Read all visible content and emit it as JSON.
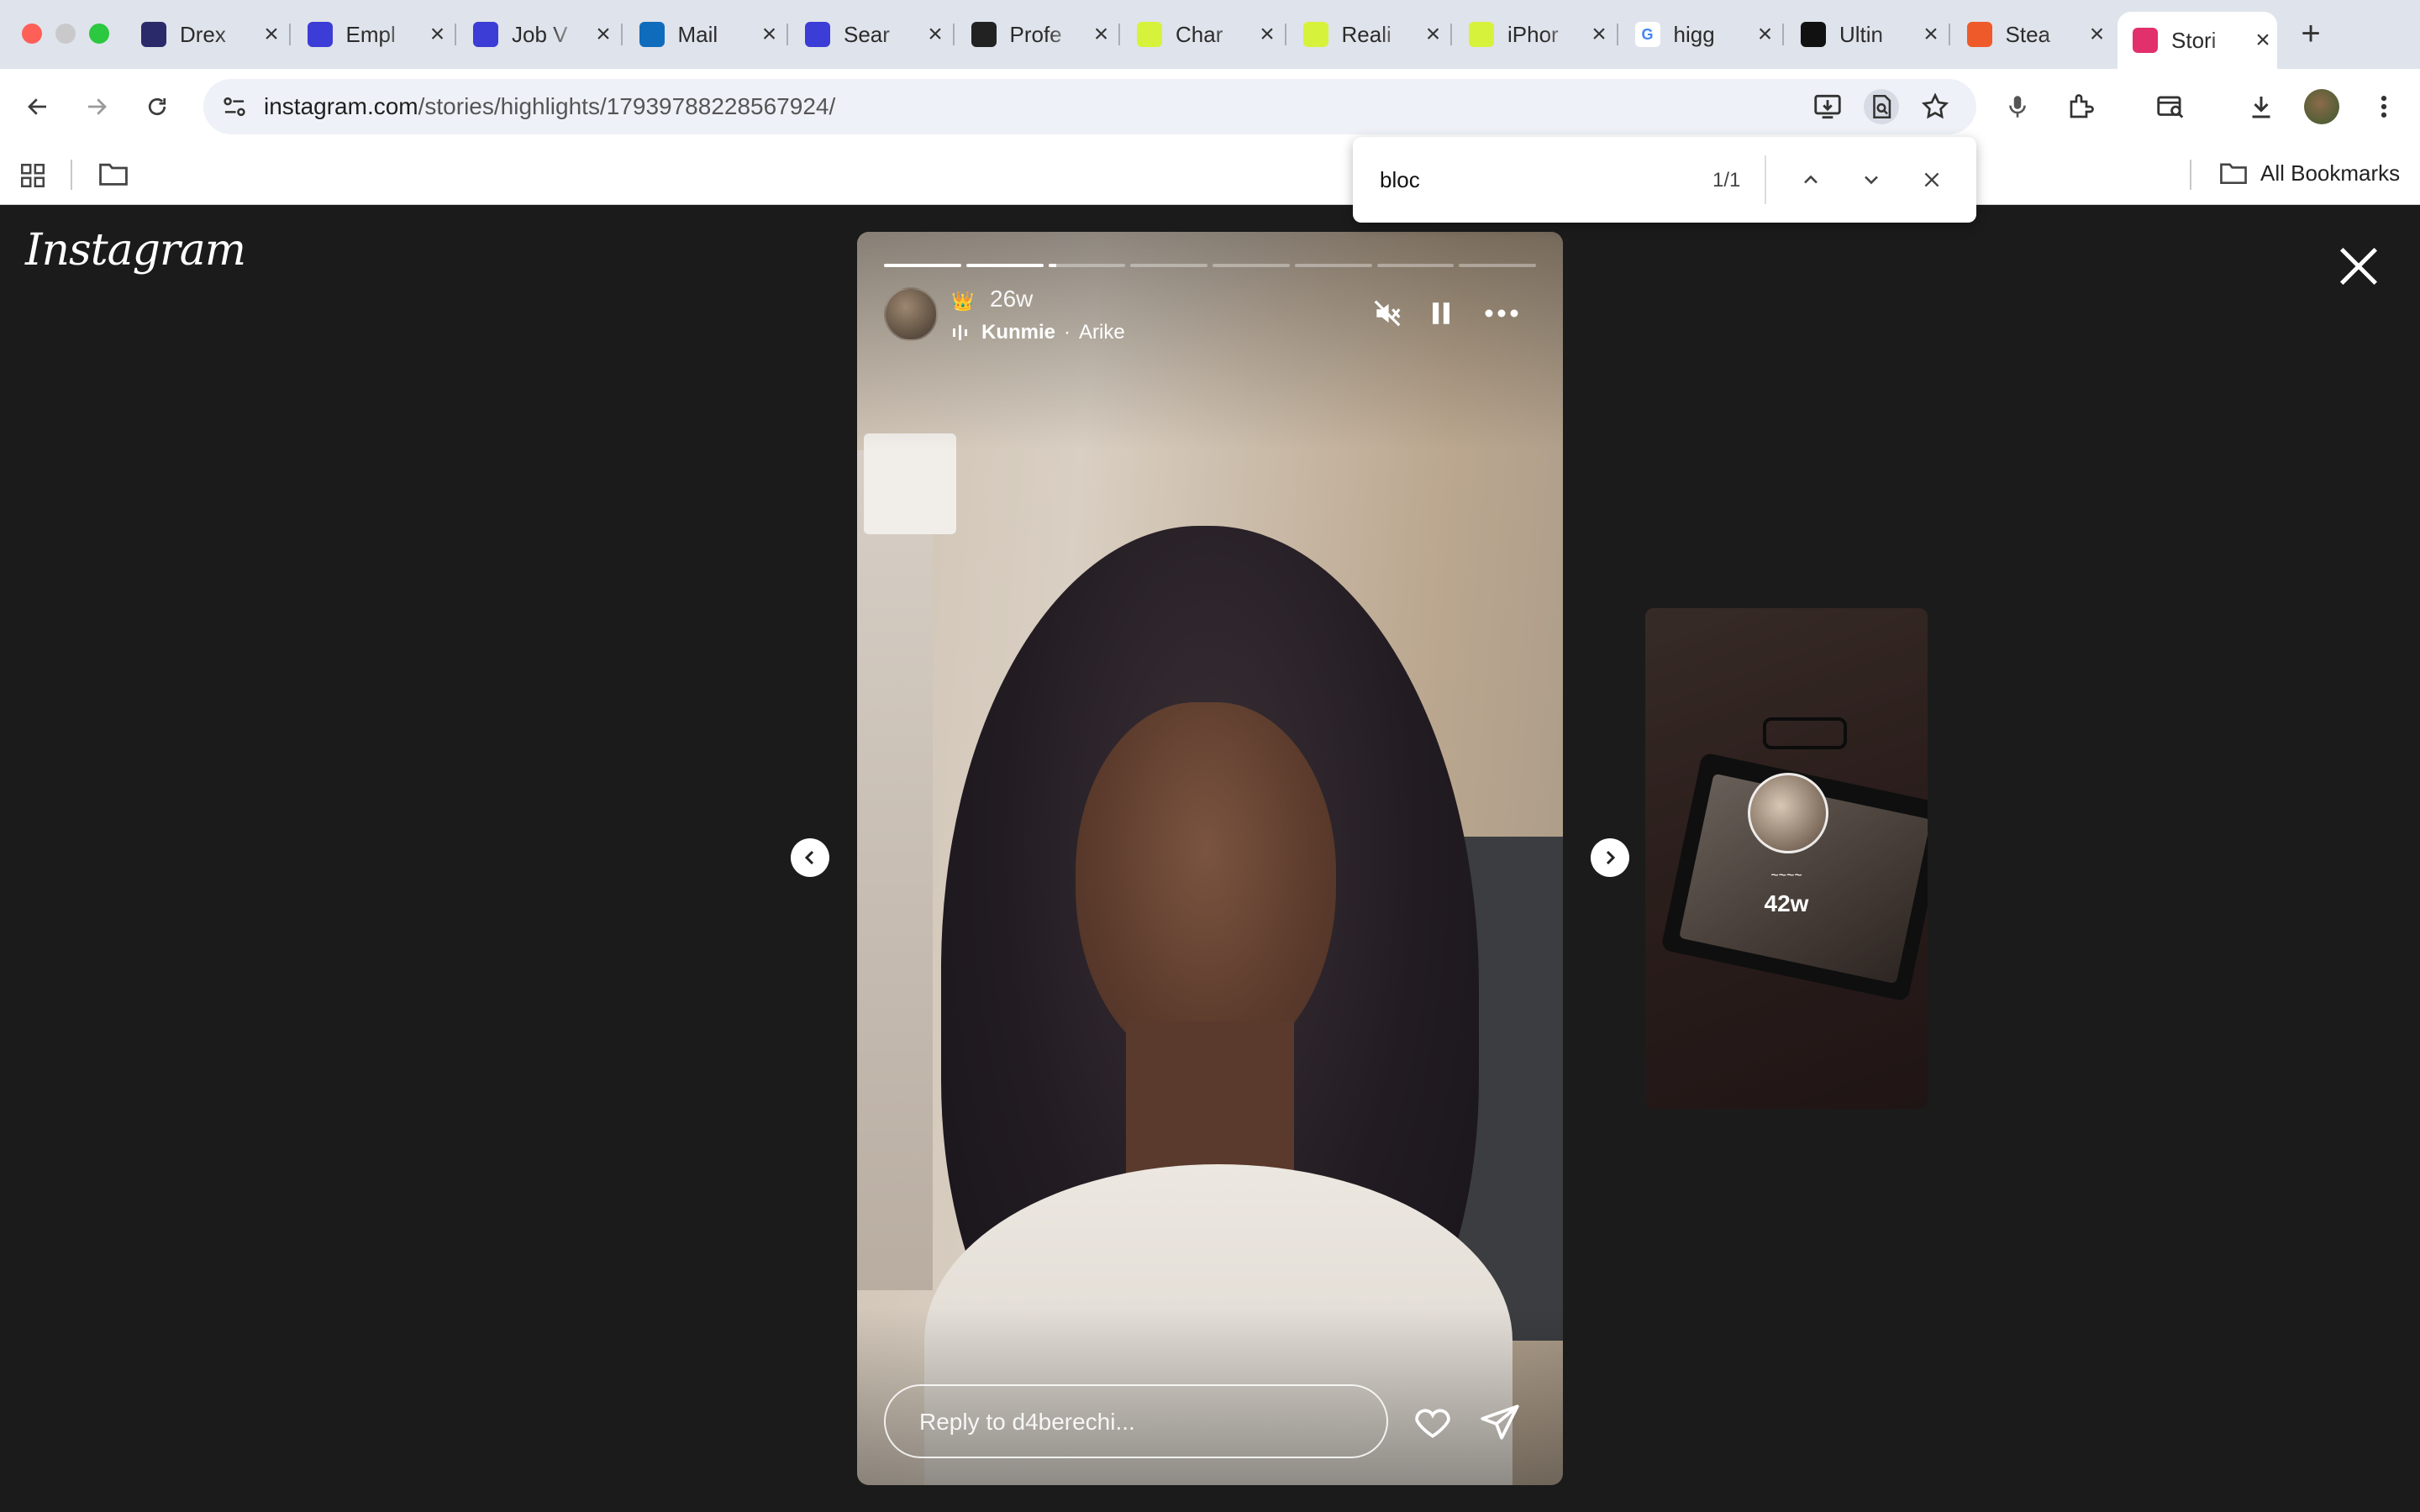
{
  "browser": {
    "tabs": [
      {
        "label": "Drex",
        "favicon": "dragon-icon",
        "color": "#2a2a6a"
      },
      {
        "label": "Empl",
        "favicon": "blue-book-icon",
        "color": "#3c3cd6"
      },
      {
        "label": "Job V",
        "favicon": "blue-book-icon",
        "color": "#3c3cd6"
      },
      {
        "label": "Mail",
        "favicon": "outlook-icon",
        "color": "#0f6cbd"
      },
      {
        "label": "Sear",
        "favicon": "blue-book-icon",
        "color": "#3c3cd6"
      },
      {
        "label": "Profe",
        "favicon": "openai-icon",
        "color": "#222222"
      },
      {
        "label": "Char",
        "favicon": "yellow-swirl-icon",
        "color": "#d7f23b"
      },
      {
        "label": "Reali",
        "favicon": "yellow-swirl-icon",
        "color": "#d7f23b"
      },
      {
        "label": "iPhor",
        "favicon": "yellow-swirl-icon",
        "color": "#d7f23b"
      },
      {
        "label": "higg",
        "favicon": "google-icon",
        "color": "#ffffff"
      },
      {
        "label": "Ultin",
        "favicon": "film-icon",
        "color": "#111111"
      },
      {
        "label": "Stea",
        "favicon": "bookmark-orange-icon",
        "color": "#ef5a2a"
      },
      {
        "label": "Stori",
        "favicon": "instagram-icon",
        "color": "#e1306c"
      }
    ],
    "url_domain": "instagram.com",
    "url_path": "/stories/highlights/17939788228567924/",
    "all_bookmarks": "All Bookmarks",
    "find": {
      "query": "bloc",
      "count": "1/1"
    }
  },
  "instagram": {
    "logo": "Instagram",
    "story": {
      "time": "26w",
      "song": "Kunmie",
      "separator": "·",
      "artist": "Arike",
      "reply_placeholder": "Reply to d4berechi...",
      "progress": [
        1,
        1,
        0.1,
        0,
        0,
        0,
        0,
        0
      ]
    },
    "preview": {
      "time": "42w",
      "name": "~~~~"
    }
  }
}
